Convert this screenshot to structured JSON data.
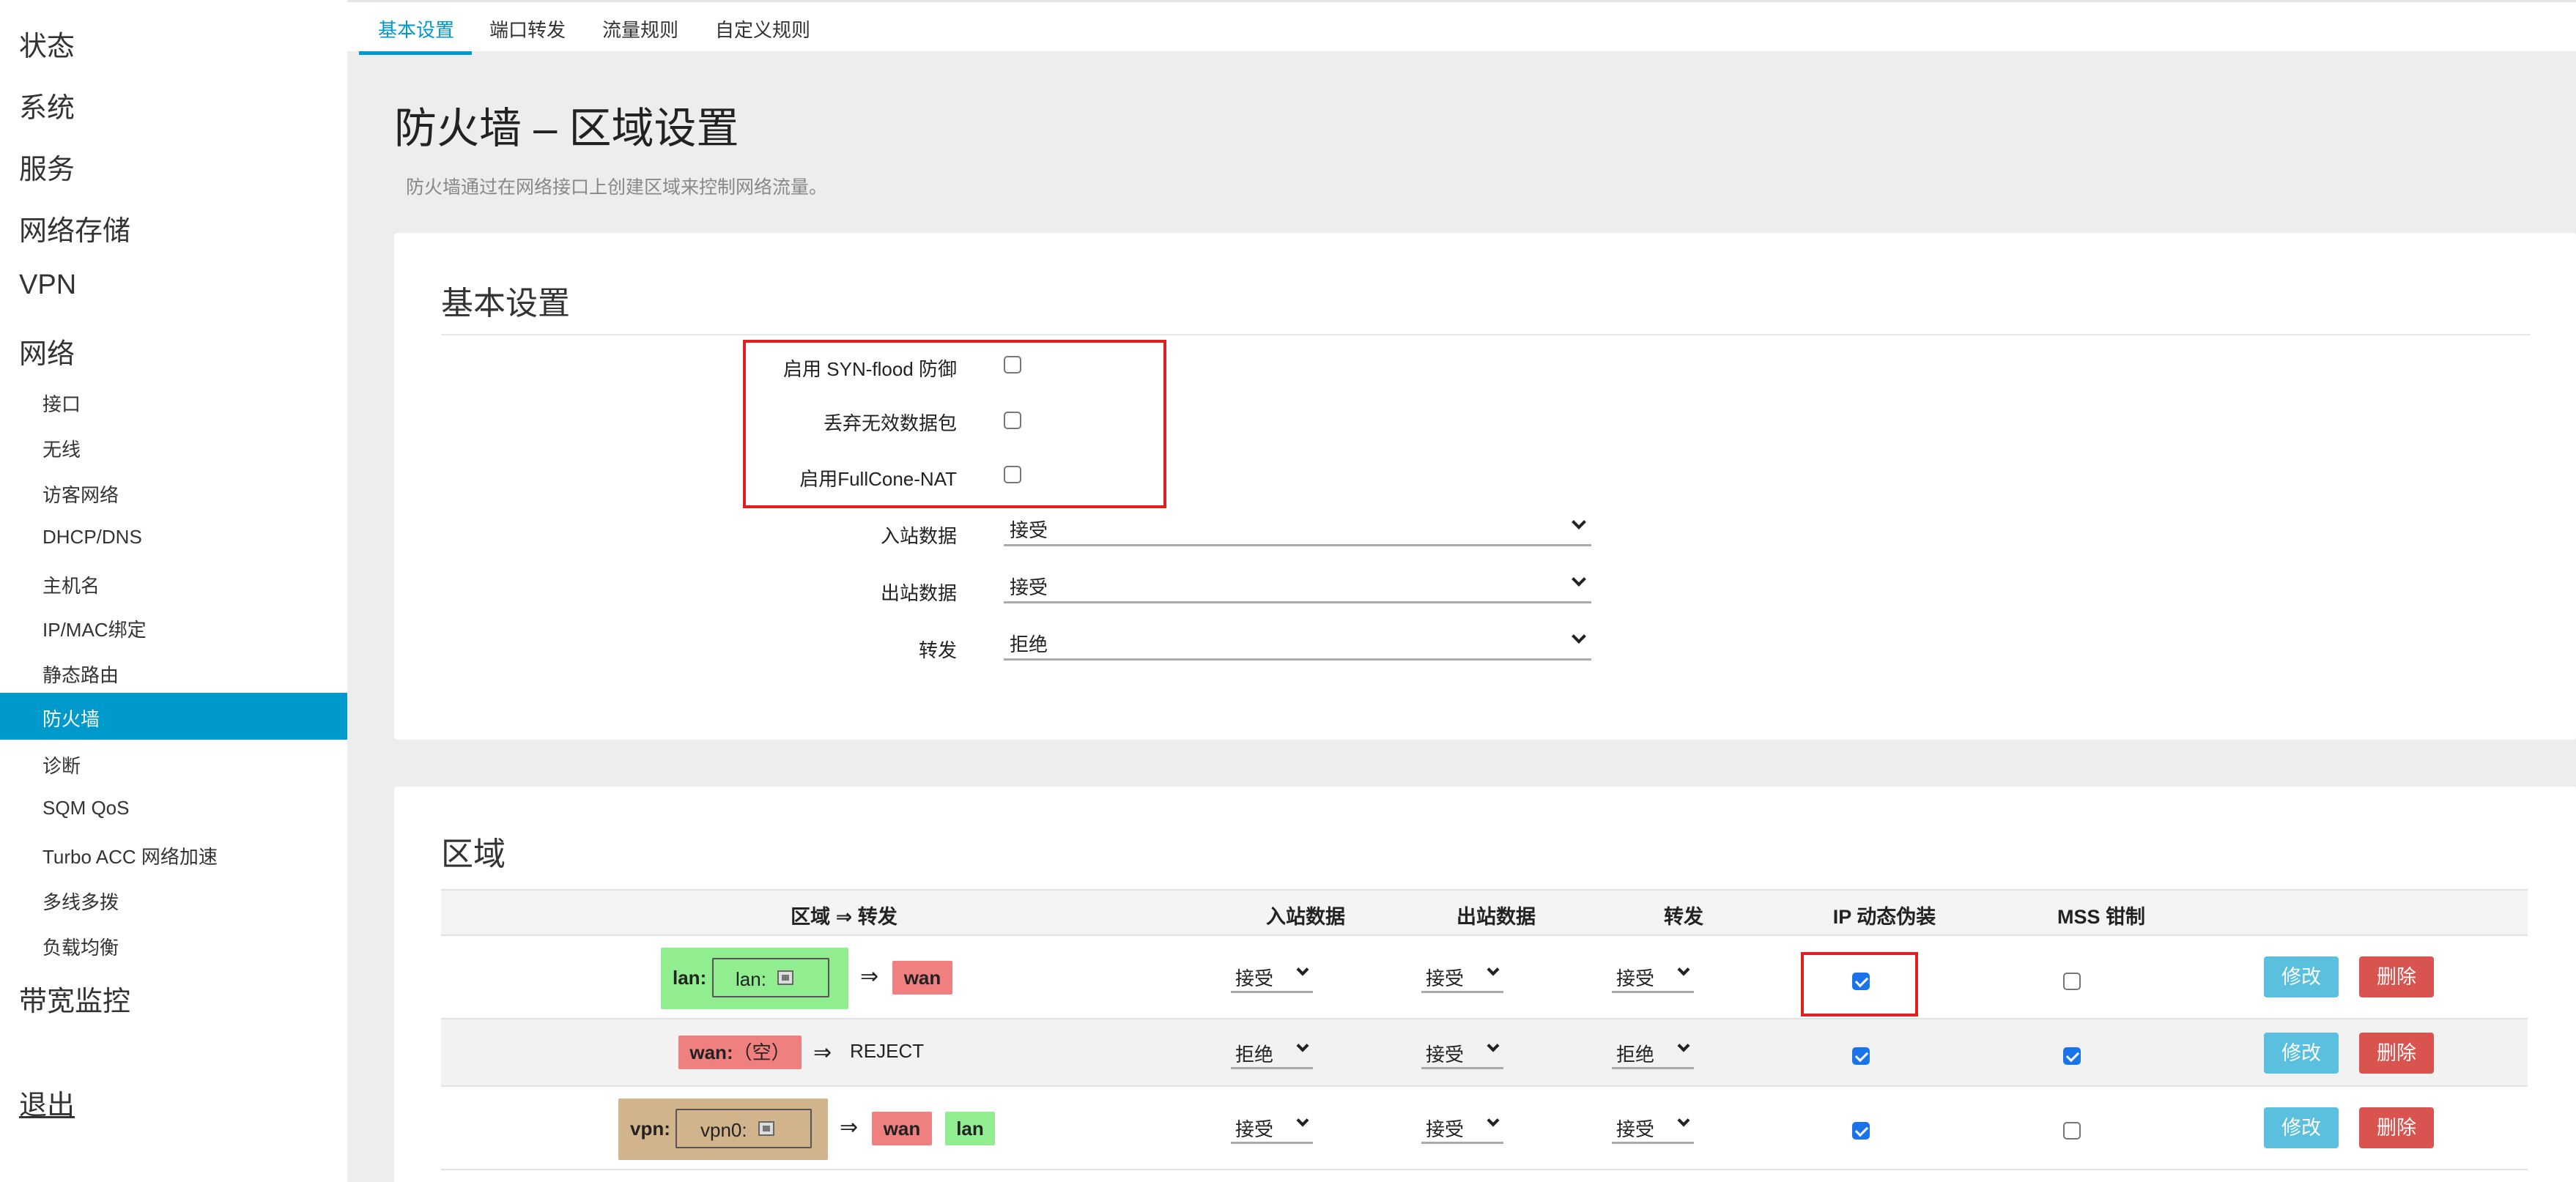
{
  "sidebar": {
    "top_items": [
      "状态",
      "系统",
      "服务",
      "网络存储",
      "VPN",
      "网络"
    ],
    "sub_items": [
      "接口",
      "无线",
      "访客网络",
      "DHCP/DNS",
      "主机名",
      "IP/MAC绑定",
      "静态路由",
      "防火墙",
      "诊断",
      "SQM QoS",
      "Turbo ACC 网络加速",
      "多线多拨",
      "负载均衡"
    ],
    "active_item": "防火墙",
    "bandwidth": "带宽监控",
    "logout": "退出"
  },
  "tabs": [
    "基本设置",
    "端口转发",
    "流量规则",
    "自定义规则"
  ],
  "page": {
    "title": "防火墙 – 区域设置",
    "description": "防火墙通过在网络接口上创建区域来控制网络流量。"
  },
  "basic": {
    "section_title": "基本设置",
    "syn_flood_label": "启用 SYN-flood 防御",
    "syn_flood_checked": false,
    "drop_invalid_label": "丢弃无效数据包",
    "drop_invalid_checked": false,
    "fullcone_label": "启用FullCone-NAT",
    "fullcone_checked": false,
    "input_label": "入站数据",
    "input_value": "接受",
    "output_label": "出站数据",
    "output_value": "接受",
    "forward_label": "转发",
    "forward_value": "拒绝"
  },
  "zones": {
    "section_title": "区域",
    "headers": [
      "区域 ⇒ 转发",
      "入站数据",
      "出站数据",
      "转发",
      "IP 动态伪装",
      "MSS 钳制"
    ],
    "arrow": "⇒",
    "edit_label": "修改",
    "delete_label": "删除",
    "rows": [
      {
        "zone": "lan:",
        "iface": "lan:",
        "targets": [
          "wan"
        ],
        "input": "接受",
        "output": "接受",
        "forward": "接受",
        "masq": true,
        "mss": false
      },
      {
        "zone": "wan:",
        "iface": "（空）",
        "targets": [
          "REJECT"
        ],
        "input": "拒绝",
        "output": "接受",
        "forward": "拒绝",
        "masq": true,
        "mss": true
      },
      {
        "zone": "vpn:",
        "iface": "vpn0:",
        "targets": [
          "wan",
          "lan"
        ],
        "input": "接受",
        "output": "接受",
        "forward": "接受",
        "masq": true,
        "mss": false
      }
    ]
  },
  "colors": {
    "accent": "#0099cc",
    "highlight": "#e02020",
    "zone_lan": "#90ee90",
    "zone_wan": "#f08080",
    "zone_vpn": "#d2b48c",
    "btn_edit": "#5bc0de",
    "btn_delete": "#d9534f"
  },
  "icons": [
    "network-port-icon"
  ]
}
